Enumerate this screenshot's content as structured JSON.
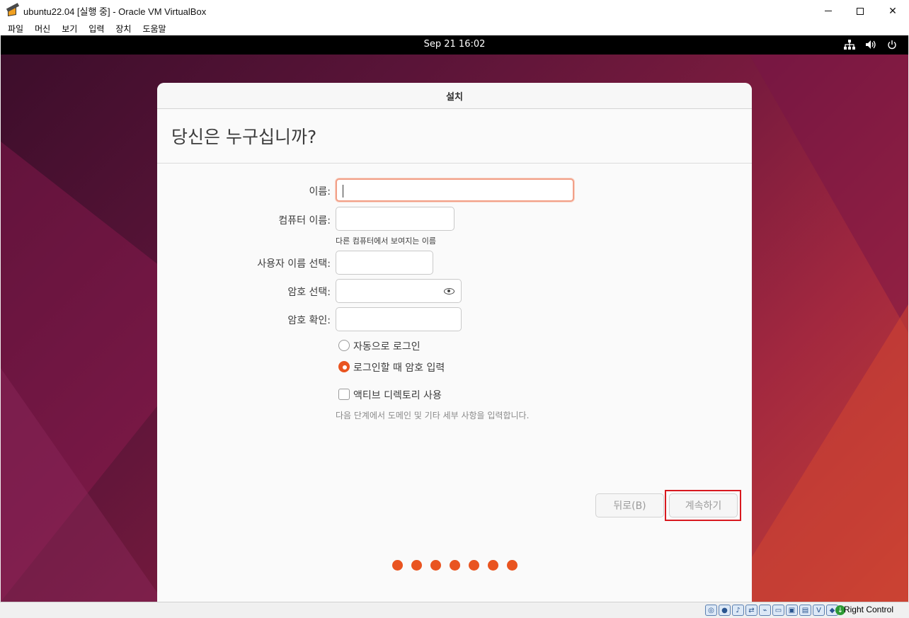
{
  "window": {
    "title": "ubuntu22.04 [실행 중] - Oracle VM VirtualBox",
    "icon": "virtualbox-icon"
  },
  "menubar": {
    "items": [
      "파일",
      "머신",
      "보기",
      "입력",
      "장치",
      "도움말"
    ]
  },
  "vm_topbar": {
    "clock": "Sep 21  16:02",
    "tray_icons": [
      "network-icon",
      "volume-icon",
      "power-icon"
    ]
  },
  "dialog": {
    "header": "설치",
    "page_title": "당신은 누구십니까?",
    "fields": {
      "name_label": "이름:",
      "name_value": "",
      "computer_label": "컴퓨터 이름:",
      "computer_hint": "다른 컴퓨터에서 보여지는 이름",
      "username_label": "사용자 이름 선택:",
      "password_label": "암호 선택:",
      "confirm_label": "암호 확인:"
    },
    "options": {
      "auto_login": "자동으로 로그인",
      "require_password": "로그인할 때 암호 입력",
      "selected": "require_password",
      "active_directory": "액티브 디렉토리 사용",
      "active_directory_checked": false,
      "ad_hint": "다음 단계에서 도메인 및 기타 세부 사항을 입력합니다."
    },
    "buttons": {
      "back": "뒤로(B)",
      "continue": "계속하기"
    },
    "progress": {
      "total_steps": 7,
      "completed_steps": 7
    },
    "accent_color": "#e95420"
  },
  "statusbar": {
    "host_key": "Right Control"
  }
}
